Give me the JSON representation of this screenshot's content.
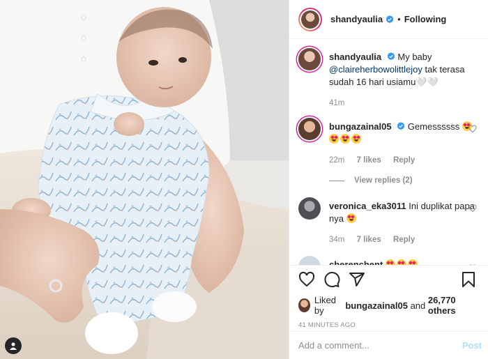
{
  "post": {
    "author": "shandyaulia",
    "follow_status": "Following",
    "separator": "•"
  },
  "caption": {
    "username": "shandyaulia",
    "text_before": "My baby",
    "mention": "@claireherbowolittlejoy",
    "text_after": "tak terasa sudah 16 hari usiamu🤍🤍",
    "time": "41m"
  },
  "comments": [
    {
      "username": "bungazainal05",
      "verified": true,
      "text": "Gemessssss",
      "time": "22m",
      "likes": "7 likes",
      "reply": "Reply",
      "view_replies": "View replies (2)"
    },
    {
      "username": "veronica_eka3011",
      "verified": false,
      "text": "Ini duplikat papa nya",
      "time": "34m",
      "likes": "7 likes",
      "reply": "Reply"
    },
    {
      "username": "cherenchent",
      "verified": false,
      "text": ""
    }
  ],
  "likes": {
    "prefix": "Liked by",
    "user": "bungazainal05",
    "joiner": "and",
    "count": "26,770 others"
  },
  "timestamp": "41 MINUTES AGO",
  "add_comment": {
    "placeholder": "Add a comment...",
    "post_label": "Post"
  },
  "icons": {
    "like": "heart-icon",
    "comment": "comment-icon",
    "share": "share-icon",
    "save": "bookmark-icon",
    "verified": "verified-badge-icon",
    "user_tag": "user-tag-icon"
  },
  "colors": {
    "text": "#262626",
    "secondary": "#8e8e8e",
    "link": "#00376b",
    "verified": "#3897f0",
    "post_disabled": "#b2dffc"
  }
}
